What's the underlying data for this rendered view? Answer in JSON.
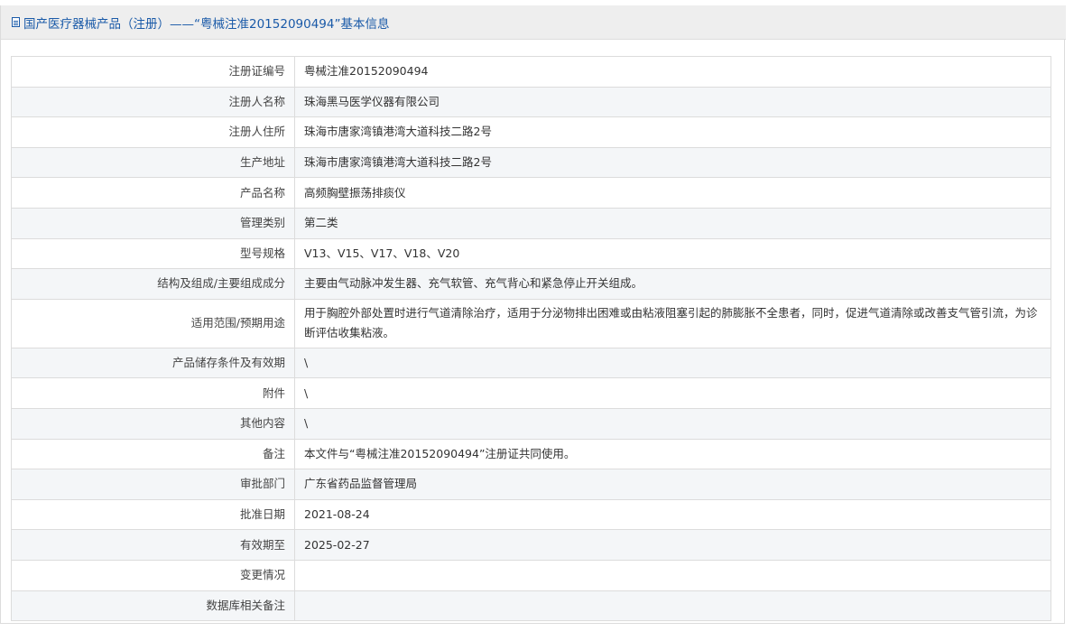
{
  "header": {
    "title": "国产医疗器械产品（注册）——“粤械注准20152090494”基本信息"
  },
  "rows": [
    {
      "label": "注册证编号",
      "value": "粤械注准20152090494"
    },
    {
      "label": "注册人名称",
      "value": "珠海黑马医学仪器有限公司"
    },
    {
      "label": "注册人住所",
      "value": "珠海市唐家湾镇港湾大道科技二路2号"
    },
    {
      "label": "生产地址",
      "value": "珠海市唐家湾镇港湾大道科技二路2号"
    },
    {
      "label": "产品名称",
      "value": "高频胸壁振荡排痰仪"
    },
    {
      "label": "管理类别",
      "value": "第二类"
    },
    {
      "label": "型号规格",
      "value": "V13、V15、V17、V18、V20"
    },
    {
      "label": "结构及组成/主要组成成分",
      "value": "主要由气动脉冲发生器、充气软管、充气背心和紧急停止开关组成。"
    },
    {
      "label": "适用范围/预期用途",
      "value": "用于胸腔外部处置时进行气道清除治疗，适用于分泌物排出困难或由粘液阻塞引起的肺膨胀不全患者，同时，促进气道清除或改善支气管引流，为诊断评估收集粘液。"
    },
    {
      "label": "产品储存条件及有效期",
      "value": "\\"
    },
    {
      "label": "附件",
      "value": "\\"
    },
    {
      "label": "其他内容",
      "value": "\\"
    },
    {
      "label": "备注",
      "value": "本文件与“粤械注准20152090494”注册证共同使用。"
    },
    {
      "label": "审批部门",
      "value": "广东省药品监督管理局"
    },
    {
      "label": "批准日期",
      "value": "2021-08-24"
    },
    {
      "label": "有效期至",
      "value": "2025-02-27"
    },
    {
      "label": "变更情况",
      "value": ""
    },
    {
      "label": "数据库相关备注",
      "value": ""
    }
  ]
}
